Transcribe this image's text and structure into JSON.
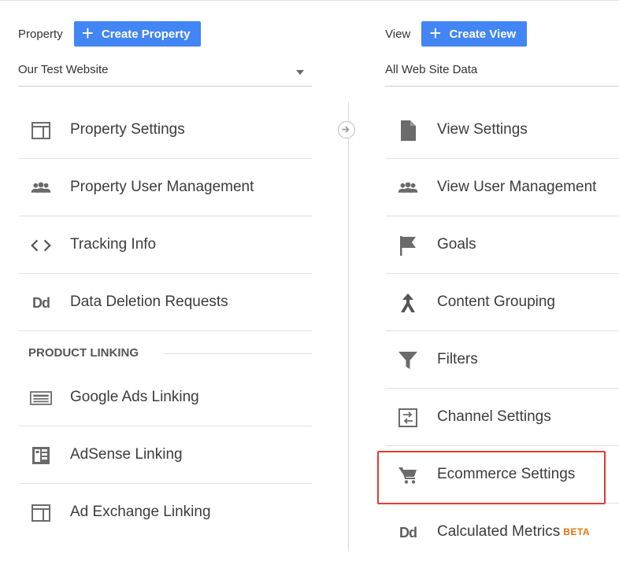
{
  "property": {
    "label": "Property",
    "create_label": "Create Property",
    "selected": "Our Test Website",
    "items": [
      {
        "label": "Property Settings"
      },
      {
        "label": "Property User Management"
      },
      {
        "label": "Tracking Info"
      },
      {
        "label": "Data Deletion Requests",
        "icon_text": "Dd"
      }
    ],
    "linking_section": {
      "title": "PRODUCT LINKING",
      "items": [
        {
          "label": "Google Ads Linking"
        },
        {
          "label": "AdSense Linking"
        },
        {
          "label": "Ad Exchange Linking"
        }
      ]
    }
  },
  "view": {
    "label": "View",
    "create_label": "Create View",
    "selected": "All Web Site Data",
    "items": [
      {
        "label": "View Settings"
      },
      {
        "label": "View User Management"
      },
      {
        "label": "Goals"
      },
      {
        "label": "Content Grouping"
      },
      {
        "label": "Filters"
      },
      {
        "label": "Channel Settings"
      },
      {
        "label": "Ecommerce Settings",
        "highlighted": true
      },
      {
        "label": "Calculated Metrics",
        "icon_text": "Dd",
        "badge": "BETA"
      }
    ]
  },
  "colors": {
    "accent": "#4285f4",
    "highlight": "#e53935",
    "beta": "#e8710a"
  }
}
